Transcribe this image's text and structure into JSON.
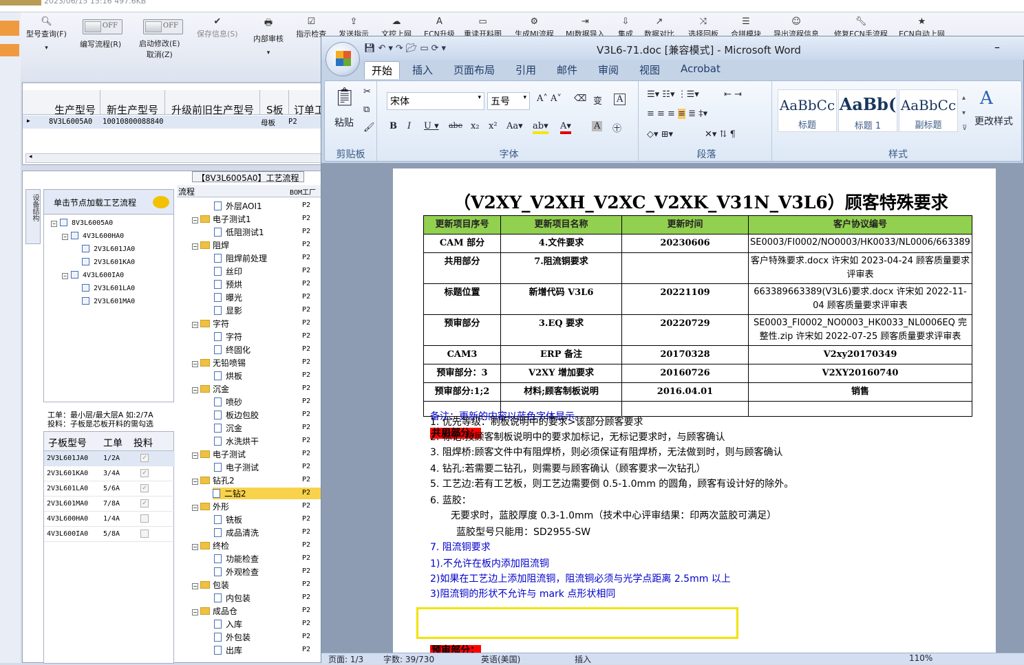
{
  "topstrip": {
    "text": "2023/06/15 15:16    497.6KB"
  },
  "toolbar": {
    "items": [
      {
        "icon": "search-icon",
        "label": "型号查询(F)"
      },
      {
        "label": "编写流程(R)",
        "toggle": "OFF"
      },
      {
        "label": "启动修改(E)",
        "sub": "取消(Z)",
        "toggle": "OFF"
      },
      {
        "icon": "check-icon",
        "label": "保存信息(S)",
        "disabled": true
      },
      {
        "icon": "print-icon",
        "label": "内部审核"
      },
      {
        "icon": "checklist-icon",
        "label": "指示检查"
      },
      {
        "icon": "upload-icon",
        "label": "发送指示"
      },
      {
        "icon": "cloud-upload-icon",
        "label": "文控上网"
      },
      {
        "icon": "a-icon",
        "label": "ECN升级"
      },
      {
        "icon": "image-icon",
        "label": "重读开料图"
      },
      {
        "icon": "gears-icon",
        "label": "生成MI流程"
      },
      {
        "icon": "import-icon",
        "label": "MI数据导入"
      },
      {
        "icon": "download-icon",
        "label": "集成"
      },
      {
        "icon": "compare-icon",
        "label": "数据对比"
      },
      {
        "icon": "shuffle-icon",
        "label": "选择回板"
      },
      {
        "icon": "list-icon",
        "label": "合拼模块"
      },
      {
        "icon": "smile-icon",
        "label": "导出流程信息"
      },
      {
        "icon": "wrench-icon",
        "label": "修复ECN手流程"
      },
      {
        "icon": "star-icon",
        "label": "ECN自动上网"
      }
    ]
  },
  "grid": {
    "headers": [
      "生产型号",
      "新生产型号",
      "升级前旧生产型号",
      "S板",
      "订单工"
    ],
    "row": [
      "8V3L6005A0",
      "10010800088840",
      "",
      "母板",
      "P2"
    ]
  },
  "proc": {
    "title": "【8V3L6005A0】工艺流程",
    "vtab": "设备结构",
    "node_header": "单击节点加载工艺流程",
    "tree": [
      {
        "t": "8V3L6005A0",
        "lvl": 0
      },
      {
        "t": "4V3L600HA0",
        "lvl": 1
      },
      {
        "t": "2V3L601JA0",
        "lvl": 2
      },
      {
        "t": "2V3L601KA0",
        "lvl": 2
      },
      {
        "t": "4V3L600IA0",
        "lvl": 1
      },
      {
        "t": "2V3L601LA0",
        "lvl": 2
      },
      {
        "t": "2V3L601MA0",
        "lvl": 2
      }
    ],
    "info1": "工单：最小层/最大层A 如:2/7A",
    "info2": "投料：子板是芯板开料的需勾选",
    "sub_headers": [
      "子板型号",
      "工单",
      "投料"
    ],
    "sub_rows": [
      {
        "m": "2V3L601JA0",
        "w": "1/2A",
        "c": true
      },
      {
        "m": "2V3L601KA0",
        "w": "3/4A",
        "c": true
      },
      {
        "m": "2V3L601LA0",
        "w": "5/6A",
        "c": true
      },
      {
        "m": "2V3L601MA0",
        "w": "7/8A",
        "c": true
      },
      {
        "m": "4V3L600HA0",
        "w": "1/4A",
        "c": false
      },
      {
        "m": "4V3L600IA0",
        "w": "5/8A",
        "c": false
      }
    ],
    "flow_head": "流程",
    "bom_head": "BOM工厂",
    "flow": [
      {
        "t": "外层AOI1",
        "k": "doc",
        "p": "P2"
      },
      {
        "t": "电子测试1",
        "k": "folder",
        "p": "P2"
      },
      {
        "t": "低阻测试1",
        "k": "doc",
        "p": "P2"
      },
      {
        "t": "阻焊",
        "k": "folder",
        "p": "P2"
      },
      {
        "t": "阻焊前处理",
        "k": "doc",
        "p": "P2"
      },
      {
        "t": "丝印",
        "k": "doc",
        "p": "P2"
      },
      {
        "t": "预烘",
        "k": "doc",
        "p": "P2"
      },
      {
        "t": "曝光",
        "k": "doc",
        "p": "P2"
      },
      {
        "t": "显影",
        "k": "doc",
        "p": "P2"
      },
      {
        "t": "字符",
        "k": "folder",
        "p": "P2"
      },
      {
        "t": "字符",
        "k": "doc",
        "p": "P2"
      },
      {
        "t": "终固化",
        "k": "doc",
        "p": "P2"
      },
      {
        "t": "无铅喷锡",
        "k": "folder",
        "p": "P2"
      },
      {
        "t": "烘板",
        "k": "doc",
        "p": "P2"
      },
      {
        "t": "沉金",
        "k": "folder",
        "p": "P2"
      },
      {
        "t": "喷砂",
        "k": "doc",
        "p": "P2"
      },
      {
        "t": "板边包胶",
        "k": "doc",
        "p": "P2"
      },
      {
        "t": "沉金",
        "k": "doc",
        "p": "P2"
      },
      {
        "t": "水洗烘干",
        "k": "doc",
        "p": "P2"
      },
      {
        "t": "电子测试",
        "k": "folder",
        "p": "P2"
      },
      {
        "t": "电子测试",
        "k": "doc",
        "p": "P2"
      },
      {
        "t": "钻孔2",
        "k": "folder",
        "p": "P2"
      },
      {
        "t": "二钻2",
        "k": "doc",
        "p": "P2",
        "sel": true
      },
      {
        "t": "外形",
        "k": "folder",
        "p": "P2"
      },
      {
        "t": "铣板",
        "k": "doc",
        "p": "P2"
      },
      {
        "t": "成品清洗",
        "k": "doc",
        "p": "P2"
      },
      {
        "t": "终检",
        "k": "folder",
        "p": "P2"
      },
      {
        "t": "功能检查",
        "k": "doc",
        "p": "P2"
      },
      {
        "t": "外观检查",
        "k": "doc",
        "p": "P2"
      },
      {
        "t": "包装",
        "k": "folder",
        "p": "P2"
      },
      {
        "t": "内包装",
        "k": "doc",
        "p": "P2"
      },
      {
        "t": "成品仓",
        "k": "folder",
        "p": "P2"
      },
      {
        "t": "入库",
        "k": "doc",
        "p": "P2"
      },
      {
        "t": "外包装",
        "k": "doc",
        "p": "P2"
      },
      {
        "t": "出库",
        "k": "doc",
        "p": "P2"
      }
    ]
  },
  "word": {
    "title": "V3L6-71.doc [兼容模式] - Microsoft Word",
    "tabs": [
      "开始",
      "插入",
      "页面布局",
      "引用",
      "邮件",
      "审阅",
      "视图",
      "Acrobat"
    ],
    "clipboard": {
      "paste": "粘贴",
      "group": "剪贴板"
    },
    "font": {
      "name": "宋体",
      "size": "五号",
      "group": "字体"
    },
    "paragraph": {
      "group": "段落"
    },
    "styles": {
      "items": [
        {
          "preview": "AaBbCc",
          "name": "标题"
        },
        {
          "preview": "AaBb(",
          "name": "标题 1"
        },
        {
          "preview": "AaBbCc",
          "name": "副标题"
        }
      ],
      "change": "更改样式",
      "group": "样式"
    },
    "doc": {
      "title": "（V2XY_V2XH_V2XC_V2XK_V31N_V3L6）顾客特殊要求",
      "table_headers": [
        "更新项目序号",
        "更新项目名称",
        "更新时间",
        "客户协议编号"
      ],
      "rows": [
        {
          "a": "CAM 部分",
          "b": "4.文件要求",
          "c": "20230606",
          "d": "SE0003/FI0002/NO0003/HK0033/NL0006/663389"
        },
        {
          "a": "共用部分",
          "b": "7.阻流铜要求",
          "c": "",
          "d": "客户特殊要求.docx 许宋如 2023-04-24 顾客质量要求评审表"
        },
        {
          "a": "标题位置",
          "b": "新增代码 V3L6",
          "c": "20221109",
          "d": "663389663389(V3L6)要求.docx 许宋如 2022-11-04 顾客质量要求评审表"
        },
        {
          "a": "预审部分",
          "b": "3.EQ 要求",
          "c": "20220729",
          "d": "SE0003_FI0002_NO0003_HK0033_NL0006EQ 完整性.zip 许宋如 2022-07-25 顾客质量要求评审表"
        },
        {
          "a": "CAM3",
          "b": "ERP 备注",
          "c": "20170328",
          "d": "V2xy20170349"
        },
        {
          "a": "预审部分：3",
          "b": "V2XY 增加要求",
          "c": "20160726",
          "d": "V2XY20160740"
        },
        {
          "a": "预审部分:1;2",
          "b": "材料;顾客制板说明",
          "c": "2016.04.01",
          "d": "销售"
        },
        {
          "a": "",
          "b": "",
          "c": "",
          "d": ""
        }
      ],
      "note": "备注：更新的内容以蓝色字体显示。",
      "section1": "共用部分：",
      "lines": [
        "1. 优先等级：制板说明中的要求>该部分顾客要求",
        "2. 标记:按顾客制板说明中的要求加标记，无标记要求时，与顾客确认",
        "3. 阻焊桥:顾客文件中有阻焊桥，则必须保证有阻焊桥，无法做到时，则与顾客确认",
        "4. 钻孔:若需要二钻孔，则需要与顾客确认（顾客要求一次钻孔）",
        "5. 工艺边:若有工艺板，则工艺边需要倒 0.5-1.0mm 的圆角，顾客有设计好的除外。",
        "6. 蓝胶：",
        "无要求时，蓝胶厚度 0.3-1.0mm（技术中心评审结果：印两次蓝胶可满足）",
        "蓝胶型号只能用：SD2955-SW",
        "7. 阻流铜要求",
        "1).不允许在板内添加阻流铜",
        "2)如果在工艺边上添加阻流铜，阻流铜必须与光学点距离 2.5mm 以上",
        "3)阻流铜的形状不允许与 mark 点形状相同"
      ],
      "section2": "预审部分："
    },
    "status": {
      "page": "页面: 1/3",
      "words": "字数: 39/730",
      "lang": "英语(美国)",
      "mode": "插入",
      "zoom": "110%"
    }
  }
}
